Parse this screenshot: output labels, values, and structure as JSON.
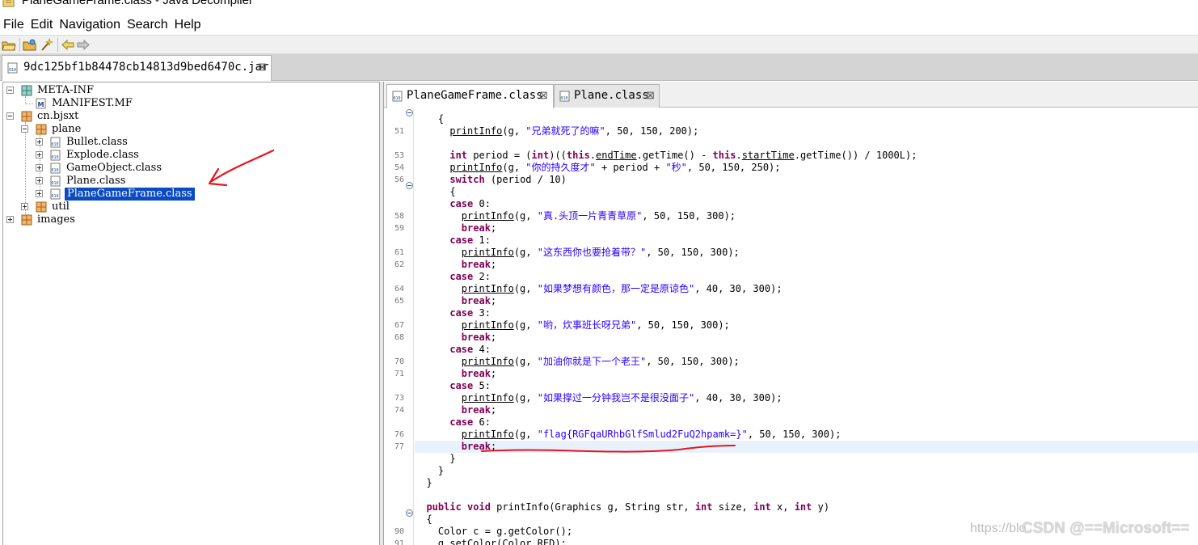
{
  "window": {
    "title": "PlaneGameFrame.class - Java Decompiler"
  },
  "menu": [
    "File",
    "Edit",
    "Navigation",
    "Search",
    "Help"
  ],
  "toolbar": [
    "open-file-icon",
    "open-folder-icon",
    "wand-icon",
    "back-arrow-icon",
    "forward-arrow-icon"
  ],
  "jar_tab": {
    "label": "9dc125bf1b84478cb14813d9bed6470c.jar",
    "close": "⊠"
  },
  "tree": [
    {
      "label": "META-INF",
      "kind": "package-open"
    },
    {
      "label": "MANIFEST.MF",
      "kind": "manifest"
    },
    {
      "label": "cn.bjsxt",
      "kind": "package-open"
    },
    {
      "label": "plane",
      "kind": "package-open"
    },
    {
      "label": "Bullet.class",
      "kind": "class"
    },
    {
      "label": "Explode.class",
      "kind": "class"
    },
    {
      "label": "GameObject.class",
      "kind": "class"
    },
    {
      "label": "Plane.class",
      "kind": "class"
    },
    {
      "label": "PlaneGameFrame.class",
      "kind": "class",
      "selected": true
    },
    {
      "label": "util",
      "kind": "package"
    },
    {
      "label": "images",
      "kind": "package"
    }
  ],
  "editor_tabs": [
    {
      "label": "PlaneGameFrame.class",
      "close": "⊠",
      "active": true
    },
    {
      "label": "Plane.class",
      "close": "⊠",
      "active": false
    }
  ],
  "code": [
    {
      "num": "",
      "fold": true,
      "text": "    {"
    },
    {
      "num": "51",
      "text": "      printInfo(g, \"兄弟就死了的嘛\", 50, 150, 200);"
    },
    {
      "num": "",
      "text": ""
    },
    {
      "num": "53",
      "text": "      int period = (int)((this.endTime.getTime() - this.startTime.getTime()) / 1000L);"
    },
    {
      "num": "54",
      "text": "      printInfo(g, \"你的持久度才\" + period + \"秒\", 50, 150, 250);"
    },
    {
      "num": "56",
      "text": "      switch (period / 10)"
    },
    {
      "num": "",
      "fold": true,
      "text": "      {"
    },
    {
      "num": "",
      "text": "      case 0:"
    },
    {
      "num": "58",
      "text": "        printInfo(g, \"真.头顶一片青青草原\", 50, 150, 300);"
    },
    {
      "num": "59",
      "text": "        break;"
    },
    {
      "num": "",
      "text": "      case 1:"
    },
    {
      "num": "61",
      "text": "        printInfo(g, \"这东西你也要抢着带？\", 50, 150, 300);"
    },
    {
      "num": "62",
      "text": "        break;"
    },
    {
      "num": "",
      "text": "      case 2:"
    },
    {
      "num": "64",
      "text": "        printInfo(g, \"如果梦想有颜色，那一定是原谅色\", 40, 30, 300);"
    },
    {
      "num": "65",
      "text": "        break;"
    },
    {
      "num": "",
      "text": "      case 3:"
    },
    {
      "num": "67",
      "text": "        printInfo(g, \"哟，炊事班长呀兄弟\", 50, 150, 300);"
    },
    {
      "num": "68",
      "text": "        break;"
    },
    {
      "num": "",
      "text": "      case 4:"
    },
    {
      "num": "70",
      "text": "        printInfo(g, \"加油你就是下一个老王\", 50, 150, 300);"
    },
    {
      "num": "71",
      "text": "        break;"
    },
    {
      "num": "",
      "text": "      case 5:"
    },
    {
      "num": "73",
      "text": "        printInfo(g, \"如果撑过一分钟我岂不是很没面子\", 40, 30, 300);"
    },
    {
      "num": "74",
      "text": "        break;"
    },
    {
      "num": "",
      "text": "      case 6:"
    },
    {
      "num": "76",
      "text": "        printInfo(g, \"flag{RGFqaURhbGlfSmlud2FuQ2hpamk=}\", 50, 150, 300);"
    },
    {
      "num": "77",
      "text": "        break;",
      "highlight": true
    },
    {
      "num": "",
      "text": "      }"
    },
    {
      "num": "",
      "text": "    }"
    },
    {
      "num": "",
      "text": "  }"
    },
    {
      "num": "",
      "text": ""
    },
    {
      "num": "",
      "text": "  public void printInfo(Graphics g, String str, int size, int x, int y)"
    },
    {
      "num": "",
      "fold": true,
      "text": "  {"
    },
    {
      "num": "90",
      "text": "    Color c = g.getColor();"
    },
    {
      "num": "91",
      "text": "    g.setColor(Color.RED);"
    }
  ],
  "watermark": {
    "url": "https://blo",
    "credit": "CSDN @==Microsoft=="
  },
  "colors": {
    "selection": "#0a4ac3",
    "keyword": "#7f0055",
    "string": "#2a00ff",
    "annotation": "#e8141d"
  }
}
